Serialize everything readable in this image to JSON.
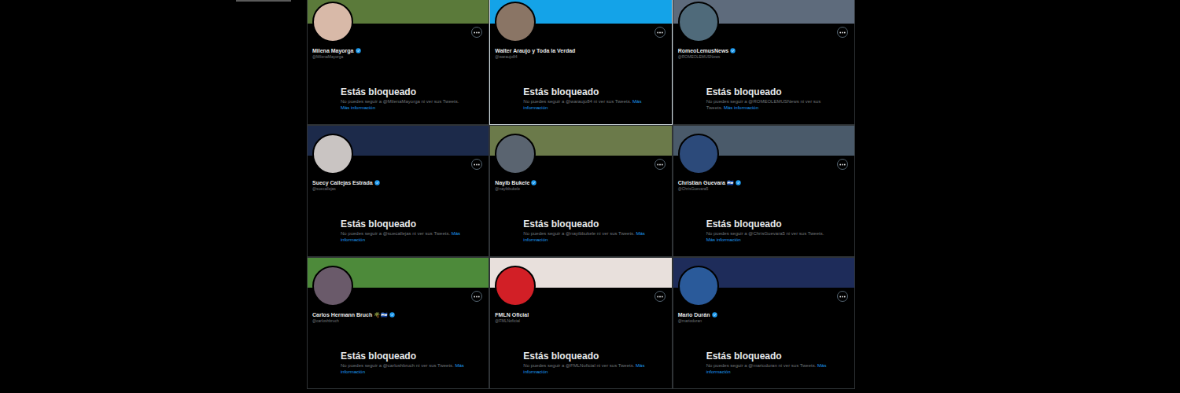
{
  "cards": [
    {
      "name": "Milena Mayorga",
      "handle": "@MilenaMayorga",
      "verified": true,
      "highlighted": false,
      "color": "#5b7a3a",
      "avatar_color": "#d8b9a8",
      "blocked_title": "Estás bloqueado",
      "message": "No puedes seguir a @MilenaMayorga ni ver sus Tweets.",
      "link": "Más información"
    },
    {
      "name": "Walter Araujo y Toda la Verdad",
      "handle": "@waraujo84",
      "verified": false,
      "highlighted": true,
      "color": "#14a3e8",
      "avatar_color": "#8a7565",
      "blocked_title": "Estás bloqueado",
      "message": "No puedes seguir a @waraujo84 ni ver sus Tweets.",
      "link": "Más información"
    },
    {
      "name": "RomeoLemusNews",
      "handle": "@ROMEOLEMUSNews",
      "verified": true,
      "highlighted": false,
      "color": "#5e6b7c",
      "avatar_color": "#4f6a7a",
      "blocked_title": "Estás bloqueado",
      "message": "No puedes seguir a @ROMEOLEMUSNews ni ver sus Tweets.",
      "link": "Más información"
    },
    {
      "name": "Suecy Callejas Estrada",
      "handle": "@suecallejas",
      "verified": true,
      "highlighted": false,
      "color": "#1c2a4a",
      "avatar_color": "#c9c4c2",
      "blocked_title": "Estás bloqueado",
      "message": "No puedes seguir a @suecallejas ni ver sus Tweets.",
      "link": "Más información"
    },
    {
      "name": "Nayib Bukele",
      "handle": "@nayibbukele",
      "verified": true,
      "highlighted": false,
      "color": "#6b7a4a",
      "avatar_color": "#5a6470",
      "blocked_title": "Estás bloqueado",
      "message": "No puedes seguir a @nayibbukele ni ver sus Tweets.",
      "link": "Más información"
    },
    {
      "name": "Christian Guevara 🇸🇻",
      "handle": "@ChrisGuevara5",
      "verified": true,
      "highlighted": false,
      "color": "#4a5a6a",
      "avatar_color": "#2c4a7a",
      "blocked_title": "Estás bloqueado",
      "message": "No puedes seguir a @ChrisGuevara5 ni ver sus Tweets.",
      "link": "Más información"
    },
    {
      "name": "Carlos Hermann Bruch 🌴🇸🇻",
      "handle": "@carloshbruch",
      "verified": true,
      "highlighted": false,
      "color": "#4d8a3a",
      "avatar_color": "#6a5a6a",
      "blocked_title": "Estás bloqueado",
      "message": "No puedes seguir a @carloshbruch ni ver sus Tweets.",
      "link": "Más información"
    },
    {
      "name": "FMLN Oficial",
      "handle": "@FMLNoficial",
      "verified": false,
      "highlighted": false,
      "color": "#e8e0dc",
      "avatar_color": "#d21f26",
      "blocked_title": "Estás bloqueado",
      "message": "No puedes seguir a @FMLNoficial ni ver sus Tweets.",
      "link": "Más información"
    },
    {
      "name": "Mario Durán",
      "handle": "@marioduran",
      "verified": true,
      "highlighted": false,
      "color": "#1e2c5a",
      "avatar_color": "#2a5a9a",
      "blocked_title": "Estás bloqueado",
      "message": "No puedes seguir a @marioduran ni ver sus Tweets.",
      "link": "Más información"
    }
  ]
}
